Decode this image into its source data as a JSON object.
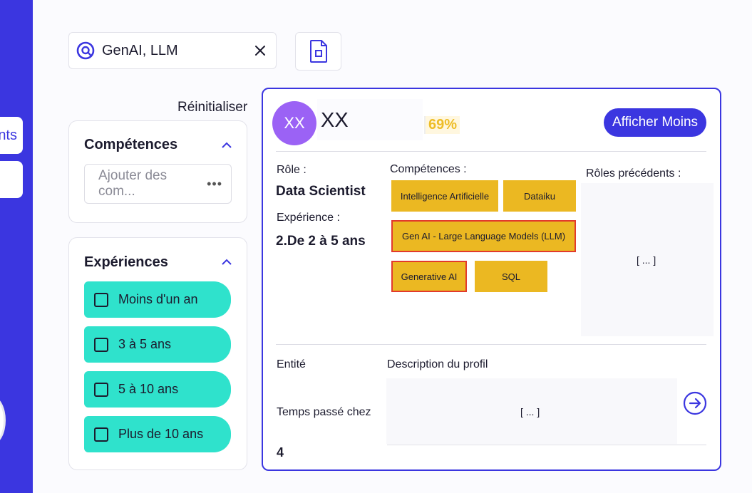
{
  "sidebar": {
    "tab_partial_label": "nts"
  },
  "search": {
    "value": "GenAI, LLM",
    "placeholder": ""
  },
  "filters": {
    "reset_label": "Réinitialiser",
    "competences": {
      "title": "Compétences",
      "input_placeholder": "Ajouter des com...",
      "more": "•••"
    },
    "experiences": {
      "title": "Expériences",
      "options": [
        "Moins d'un an",
        "3 à 5 ans",
        "5 à 10 ans",
        "Plus de 10 ans"
      ]
    }
  },
  "profile": {
    "initials": "XX",
    "name": "XX",
    "match": "69%",
    "toggle_label": "Afficher Moins",
    "role_label": "Rôle :",
    "role": "Data Scientist",
    "experience_label": "Expérience :",
    "experience": "2.De 2 à 5 ans",
    "skills_label": "Compétences :",
    "skills": [
      "Intelligence Artificielle",
      "Dataiku",
      "Gen AI - Large Language Models (LLM)",
      "Generative AI",
      "SQL"
    ],
    "previous_roles_label": "Rôles précédents :",
    "previous_roles": "[ ... ]",
    "entity_label": "Entité",
    "time_label": "Temps passé chez",
    "time_value": "4",
    "description_label": "Description du profil",
    "description": "[ ... ]"
  },
  "colors": {
    "brand": "#3b36e0",
    "teal": "#2fe2cc",
    "tag": "#ebb822",
    "highlight_border": "#e23a2c",
    "avatar": "#9b62f5"
  }
}
